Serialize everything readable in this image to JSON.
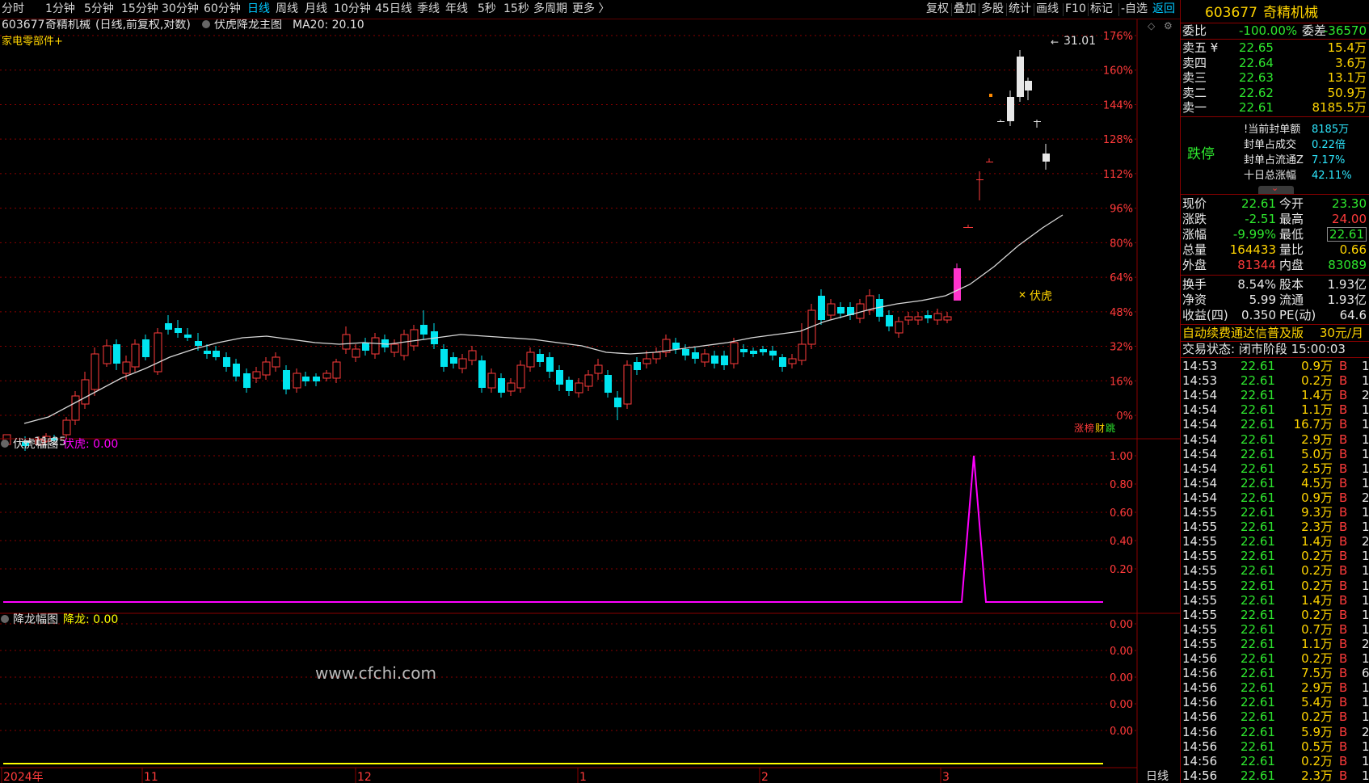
{
  "toolbar": {
    "periods": [
      "分时",
      "1分钟",
      "5分钟",
      "15分钟",
      "30分钟",
      "60分钟",
      "日线",
      "周线",
      "月线",
      "10分钟",
      "45日线",
      "季线",
      "年线",
      "5秒",
      "15秒",
      "多周期",
      "更多 〉"
    ],
    "active_period": "日线",
    "right_items": [
      "复权",
      "叠加",
      "多股",
      "统计",
      "画线",
      "F10",
      "标记",
      "-自选"
    ],
    "back_label": "返回"
  },
  "main_chart": {
    "header_code": "603677",
    "header_name": "奇精机械",
    "header_mode": "(日线,前复权,对数)",
    "indicator_name": "伏虎降龙主图",
    "ma_label": "MA20: 20.10",
    "sector": "家电零部件+",
    "high_label": "31.01",
    "low_label": "11.25",
    "signal_label": "伏虎",
    "badge": [
      "涨",
      "榜",
      "财",
      "跳"
    ],
    "y_axis_labels": [
      "176%",
      "160%",
      "144%",
      "128%",
      "112%",
      "96%",
      "80%",
      "64%",
      "48%",
      "32%",
      "16%",
      "0%"
    ]
  },
  "panel_fuhu": {
    "title": "伏虎幅图",
    "value_label": "伏虎: 0.00",
    "y_axis_labels": [
      "1.00",
      "0.80",
      "0.60",
      "0.40",
      "0.20"
    ]
  },
  "panel_jianglong": {
    "title": "降龙幅图",
    "value_label": "降龙: 0.00",
    "y_axis_labels": [
      "0.00",
      "0.00",
      "0.00",
      "0.00",
      "0.00"
    ]
  },
  "watermark": "www.cfchi.com",
  "x_axis": {
    "labels": [
      "2024年",
      "11",
      "12",
      "1",
      "2",
      "3"
    ],
    "mode": "日线"
  },
  "colors": {
    "up": "#ff3b3b",
    "down": "#00e5f0",
    "ma": "#d8d8d8",
    "fuhu": "#ff00ff",
    "jianglong": "#ffff00",
    "grid": "#8a0000"
  },
  "chart_data": {
    "type": "candlestick",
    "title": "伏虎降龙主图",
    "y_scale": "log",
    "y_axis_percent_range": [
      0,
      176
    ],
    "price_high": 31.01,
    "price_low": 11.25,
    "ma20_last": 20.1,
    "last_close": 22.61,
    "fuhu_series": {
      "name": "伏虎",
      "baseline": 0.0,
      "peak_value": 1.0,
      "peak_index": 89
    },
    "jianglong_series": {
      "name": "降龙",
      "value": 0.0
    }
  },
  "quote": {
    "code": "603677",
    "name": "奇精机械",
    "weibi_label": "委比",
    "weibi_value": "-100.00%",
    "weicha_label": "委差",
    "weicha_value": "-36570",
    "asks": [
      {
        "label": "卖五 ¥",
        "price": "22.65",
        "vol": "15.4万"
      },
      {
        "label": "卖四",
        "price": "22.64",
        "vol": "3.6万"
      },
      {
        "label": "卖三",
        "price": "22.63",
        "vol": "13.1万"
      },
      {
        "label": "卖二",
        "price": "22.62",
        "vol": "50.9万"
      },
      {
        "label": "卖一",
        "price": "22.61",
        "vol": "8185.5万"
      }
    ],
    "limit_status": "跌停",
    "seal_info": [
      {
        "label": "!当前封单额",
        "value": "8185万"
      },
      {
        "label": "封单占成交",
        "value": "0.22倍"
      },
      {
        "label": "封单占流通Z",
        "value": "7.17%"
      },
      {
        "label": "十日总涨幅",
        "value": "42.11%"
      }
    ],
    "stats": [
      {
        "l1": "现价",
        "v1": "22.61",
        "l2": "今开",
        "v2": "23.30"
      },
      {
        "l1": "涨跌",
        "v1": "-2.51",
        "l2": "最高",
        "v2": "24.00"
      },
      {
        "l1": "涨幅",
        "v1": "-9.99%",
        "l2": "最低",
        "v2": "22.61"
      },
      {
        "l1": "总量",
        "v1": "164433",
        "l2": "量比",
        "v2": "0.66"
      },
      {
        "l1": "外盘",
        "v1": "81344",
        "l2": "内盘",
        "v2": "83089"
      }
    ],
    "fund": [
      {
        "l1": "换手",
        "v1": "8.54%",
        "l2": "股本",
        "v2": "1.93亿"
      },
      {
        "l1": "净资",
        "v1": "5.99",
        "l2": "流通",
        "v2": "1.93亿"
      },
      {
        "l1": "收益(四)",
        "v1": "0.350",
        "l2": "PE(动)",
        "v2": "64.6"
      }
    ],
    "ad_text": "自动续费通达信普及版",
    "ad_price": "30元/月",
    "trade_status": "交易状态: 闭市阶段 15:00:03",
    "ticks": [
      {
        "t": "14:53",
        "p": "22.61",
        "v": "0.9万",
        "b": "B",
        "n": "1"
      },
      {
        "t": "14:53",
        "p": "22.61",
        "v": "0.2万",
        "b": "B",
        "n": "1"
      },
      {
        "t": "14:54",
        "p": "22.61",
        "v": "1.4万",
        "b": "B",
        "n": "2"
      },
      {
        "t": "14:54",
        "p": "22.61",
        "v": "1.1万",
        "b": "B",
        "n": "1"
      },
      {
        "t": "14:54",
        "p": "22.61",
        "v": "16.7万",
        "b": "B",
        "n": "1"
      },
      {
        "t": "14:54",
        "p": "22.61",
        "v": "2.9万",
        "b": "B",
        "n": "1"
      },
      {
        "t": "14:54",
        "p": "22.61",
        "v": "5.0万",
        "b": "B",
        "n": "1"
      },
      {
        "t": "14:54",
        "p": "22.61",
        "v": "2.5万",
        "b": "B",
        "n": "1"
      },
      {
        "t": "14:54",
        "p": "22.61",
        "v": "4.5万",
        "b": "B",
        "n": "1"
      },
      {
        "t": "14:54",
        "p": "22.61",
        "v": "0.9万",
        "b": "B",
        "n": "2"
      },
      {
        "t": "14:55",
        "p": "22.61",
        "v": "9.3万",
        "b": "B",
        "n": "1"
      },
      {
        "t": "14:55",
        "p": "22.61",
        "v": "2.3万",
        "b": "B",
        "n": "1"
      },
      {
        "t": "14:55",
        "p": "22.61",
        "v": "1.4万",
        "b": "B",
        "n": "2"
      },
      {
        "t": "14:55",
        "p": "22.61",
        "v": "0.2万",
        "b": "B",
        "n": "1"
      },
      {
        "t": "14:55",
        "p": "22.61",
        "v": "0.2万",
        "b": "B",
        "n": "1"
      },
      {
        "t": "14:55",
        "p": "22.61",
        "v": "0.2万",
        "b": "B",
        "n": "1"
      },
      {
        "t": "14:55",
        "p": "22.61",
        "v": "1.4万",
        "b": "B",
        "n": "1"
      },
      {
        "t": "14:55",
        "p": "22.61",
        "v": "0.2万",
        "b": "B",
        "n": "1"
      },
      {
        "t": "14:55",
        "p": "22.61",
        "v": "0.7万",
        "b": "B",
        "n": "1"
      },
      {
        "t": "14:55",
        "p": "22.61",
        "v": "1.1万",
        "b": "B",
        "n": "2"
      },
      {
        "t": "14:56",
        "p": "22.61",
        "v": "0.2万",
        "b": "B",
        "n": "1"
      },
      {
        "t": "14:56",
        "p": "22.61",
        "v": "7.5万",
        "b": "B",
        "n": "6"
      },
      {
        "t": "14:56",
        "p": "22.61",
        "v": "2.9万",
        "b": "B",
        "n": "1"
      },
      {
        "t": "14:56",
        "p": "22.61",
        "v": "5.4万",
        "b": "B",
        "n": "1"
      },
      {
        "t": "14:56",
        "p": "22.61",
        "v": "0.2万",
        "b": "B",
        "n": "1"
      },
      {
        "t": "14:56",
        "p": "22.61",
        "v": "5.9万",
        "b": "B",
        "n": "2"
      },
      {
        "t": "14:56",
        "p": "22.61",
        "v": "0.5万",
        "b": "B",
        "n": "1"
      },
      {
        "t": "14:56",
        "p": "22.61",
        "v": "0.2万",
        "b": "B",
        "n": "1"
      },
      {
        "t": "14:56",
        "p": "22.61",
        "v": "2.3万",
        "b": "B",
        "n": "1"
      }
    ]
  }
}
